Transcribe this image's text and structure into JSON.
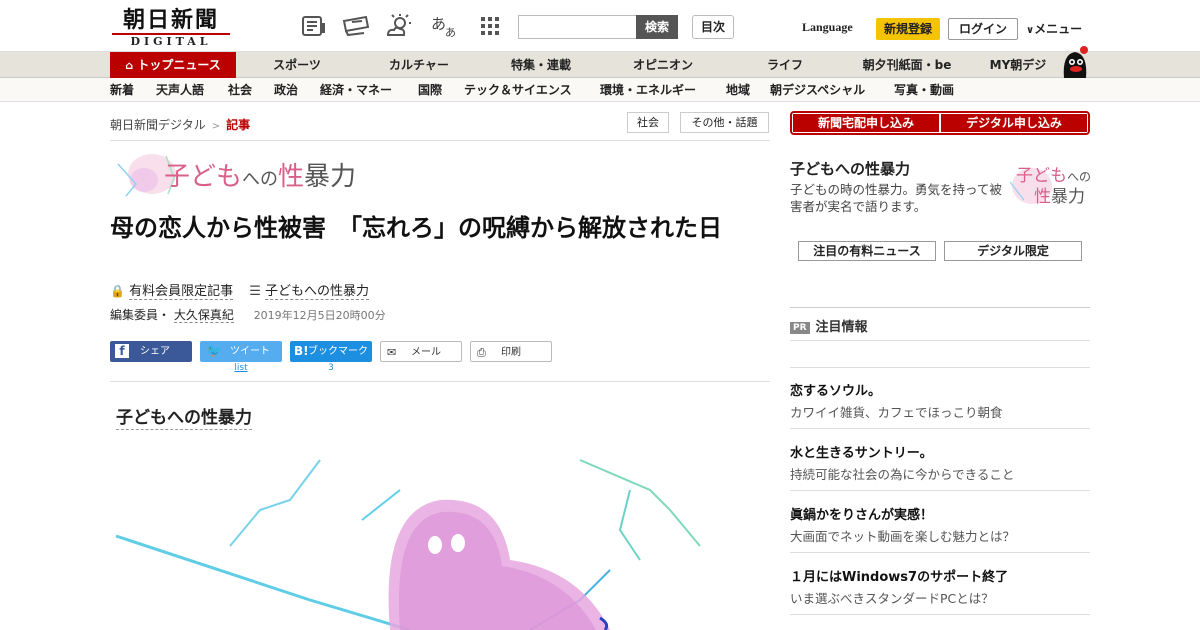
{
  "header": {
    "logo_jp": "朝日新聞",
    "logo_en": "DIGITAL",
    "search_button": "検索",
    "toc_button": "目次",
    "language": "Language",
    "signup": "新規登録",
    "login": "ログイン",
    "menu": "メニュー",
    "icons": [
      "newspaper-icon",
      "ticket-icon",
      "weather-icon",
      "font-size-icon",
      "grid-icon"
    ]
  },
  "nav": {
    "items": [
      "トップニュース",
      "スポーツ",
      "カルチャー",
      "特集・連載",
      "オピニオン",
      "ライフ",
      "朝夕刊紙面・be",
      "MY朝デジ"
    ]
  },
  "subnav": {
    "items": [
      "新着",
      "天声人語",
      "社会",
      "政治",
      "経済・マネー",
      "国際",
      "テック＆サイエンス",
      "環境・エネルギー",
      "地域",
      "朝デジスペシャル",
      "写真・動画"
    ]
  },
  "breadcrumb": {
    "home": "朝日新聞デジタル",
    "sep": ">",
    "current": "記事"
  },
  "tags": [
    "社会",
    "その他・話題"
  ],
  "article": {
    "series_banner_a": "子ども",
    "series_banner_b": "への",
    "series_banner_c": "性",
    "series_banner_d": "暴力",
    "headline": "母の恋人から性被害　「忘れろ」の呪縛から解放された日",
    "member_only": "有料会員限定記事",
    "series_link": "子どもへの性暴力",
    "author_role": "編集委員・",
    "author": "大久保真紀",
    "date": "2019年12月5日20時00分",
    "section_title": "子どもへの性暴力"
  },
  "share": {
    "share": "シェア",
    "tweet": "ツイート",
    "tweet_count": "list",
    "bookmark": "ブックマーク",
    "bookmark_count": "3",
    "mail": "メール",
    "print": "印刷"
  },
  "sidebar": {
    "subscribe_paper": "新聞宅配申し込み",
    "subscribe_digital": "デジタル申し込み",
    "series_title": "子どもへの性暴力",
    "series_desc": "子どもの時の性暴力。勇気を持って被害者が実名で語ります。",
    "logo_a": "子ども",
    "logo_b": "への",
    "logo_c": "性",
    "logo_d": "暴力",
    "btn_paid": "注目の有料ニュース",
    "btn_digital": "デジタル限定",
    "pr_badge": "PR",
    "pr_heading": "注目情報",
    "pr_items": [
      {
        "title": "恋するソウル。",
        "desc": "カワイイ雑貨、カフェでほっこり朝食"
      },
      {
        "title": "水と生きるサントリー。",
        "desc": "持続可能な社会の為に今からできること"
      },
      {
        "title": "眞鍋かをりさんが実感！",
        "desc": "大画面でネット動画を楽しむ魅力とは？"
      },
      {
        "title": "１月にはWindows7のサポート終了",
        "desc": "いま選ぶべきスタンダードPCとは？"
      }
    ]
  }
}
